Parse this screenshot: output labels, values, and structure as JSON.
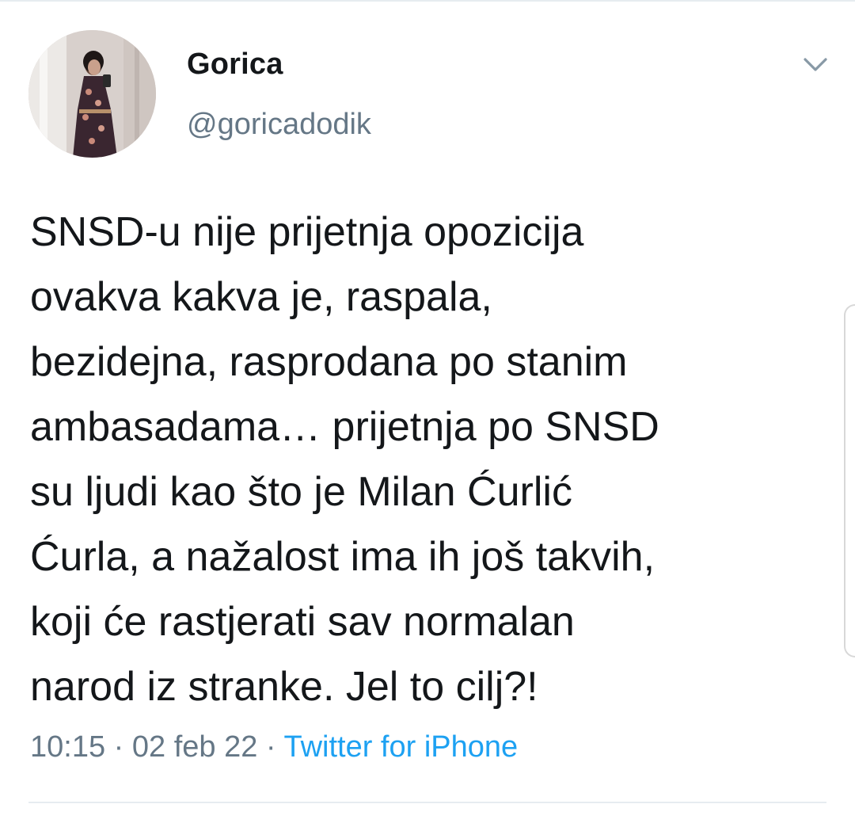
{
  "tweet": {
    "author": {
      "display_name": "Gorica",
      "handle": "@goricadodik"
    },
    "text": "SNSD-u nije prijetnja opozicija\novakva kakva je, raspala,\nbezidejna, rasprodana po stanim\nambasadama… prijetnja po SNSD\nsu ljudi kao što je Milan Ćurlić\nĆurla, a nažalost ima ih još takvih,\nkoji će rastjerati sav normalan\nnarod iz stranke. Jel to cilj?!",
    "time": "10:15",
    "date": "02 feb 22",
    "separator": "·",
    "source": "Twitter for iPhone"
  },
  "icons": {
    "menu": "chevron-down-icon",
    "avatar": "profile-avatar"
  },
  "colors": {
    "text": "#14171a",
    "secondary": "#657786",
    "link": "#1da1f2",
    "divider": "#e6ecf0"
  }
}
